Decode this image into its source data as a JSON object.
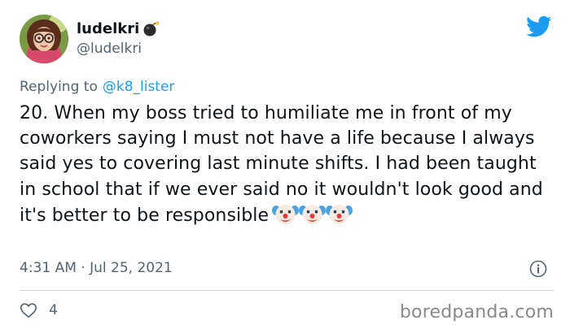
{
  "author": {
    "display_name": "ludelkri",
    "handle": "@ludelkri",
    "name_emoji_icon": "bomb-icon",
    "avatar_icon": "avatar-illustration"
  },
  "brand_logo": "twitter-bird-icon",
  "reply": {
    "prefix": "Replying to",
    "mention": "@k8_lister"
  },
  "tweet": {
    "text": "20. When my boss tried to humiliate me in front of my coworkers saying I must not have a life because I always said yes to covering last minute shifts. I had been taught in school that if we ever said no it wouldn't look good and it's better to be responsible",
    "emojis": [
      "clown-face-icon",
      "clown-face-icon",
      "clown-face-icon"
    ]
  },
  "meta": {
    "timestamp": "4:31 AM · Jul 25, 2021",
    "info_icon": "info-icon"
  },
  "actions": {
    "like_icon": "heart-icon",
    "like_count": "4"
  },
  "watermark": "boredpanda.com",
  "colors": {
    "text": "#0f1419",
    "secondary": "#536471",
    "link": "#1d9bf0",
    "divider": "#cfd9de",
    "twitter_blue": "#1d9bf0"
  }
}
